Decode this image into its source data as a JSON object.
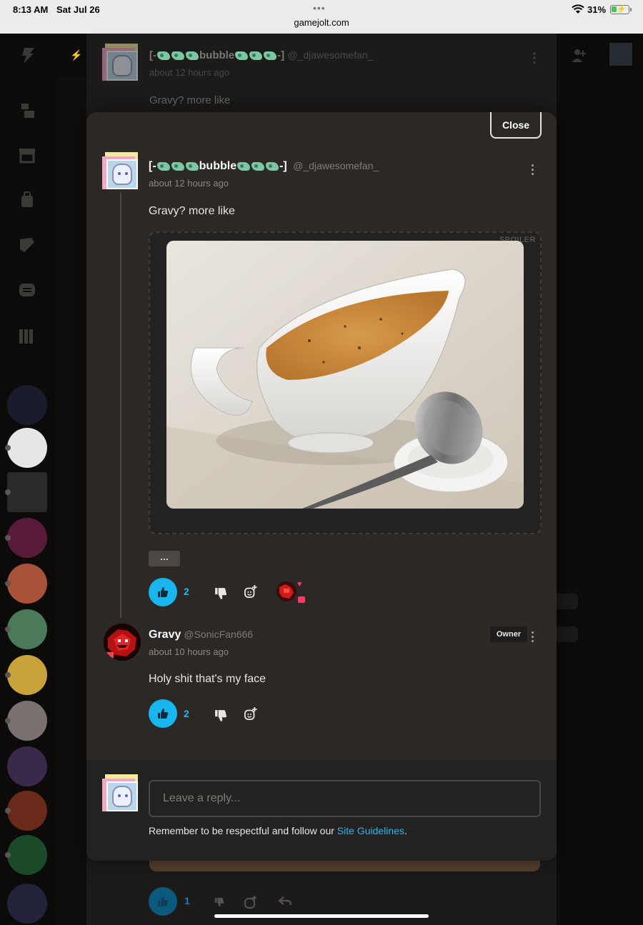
{
  "status_bar": {
    "time": "8:13 AM",
    "date": "Sat Jul 26",
    "url": "gamejolt.com",
    "battery": "31%",
    "battery_level": 0.31,
    "battery_color": "#47c45b"
  },
  "background_post": {
    "username_prefix": "[-",
    "username_mid": "bubble",
    "username_suffix": "-]",
    "handle": "@_djawesomefan_",
    "time": "about 12 hours ago",
    "text": "Gravy? more like"
  },
  "background_actions": {
    "like_count": "1"
  },
  "modal": {
    "close_label": "Close",
    "comment": {
      "username_prefix": "[-",
      "username_mid": "bubble",
      "username_suffix": "-]",
      "handle": "@_djawesomefan_",
      "time": "about 12 hours ago",
      "text": "Gravy? more like",
      "spoiler_label": "SPOILER",
      "more_label": "…",
      "like_count": "2"
    },
    "reply": {
      "username": "Gravy",
      "handle": "@SonicFan666",
      "time": "about 10 hours ago",
      "badge": "Owner",
      "text": "Holy shit that's my face",
      "like_count": "2"
    },
    "composer": {
      "placeholder": "Leave a reply...",
      "guidelines_prefix": "Remember to be respectful and follow our ",
      "guidelines_link": "Site Guidelines",
      "guidelines_suffix": "."
    }
  },
  "colors": {
    "accent": "#18b5ef",
    "modal_bg": "#2b2826",
    "page_bg": "#0f0e0d",
    "link": "#29b6f0"
  },
  "icons": {
    "like": "thumbs-up-icon",
    "dislike": "thumbs-down-icon",
    "react": "emoji-add-icon",
    "reply": "reply-arrow-icon",
    "more": "kebab-menu-icon"
  }
}
